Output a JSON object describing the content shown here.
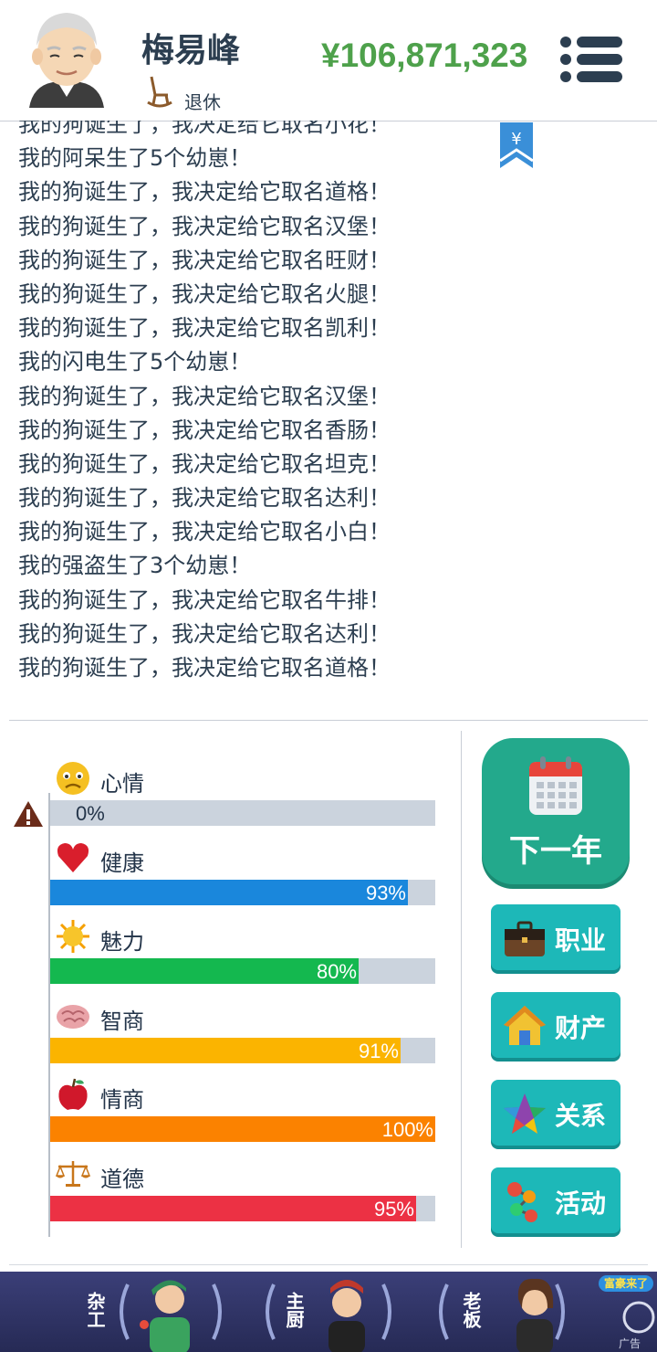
{
  "header": {
    "name": "梅易峰",
    "status": "退休",
    "money": "¥106,871,323"
  },
  "log": {
    "entries": [
      "我的狗诞生了，我决定给它取名小花！",
      "我的阿呆生了5个幼崽！",
      "我的狗诞生了，我决定给它取名道格！",
      "我的狗诞生了，我决定给它取名汉堡！",
      "我的狗诞生了，我决定给它取名旺财！",
      "我的狗诞生了，我决定给它取名火腿！",
      "我的狗诞生了，我决定给它取名凯利！",
      "我的闪电生了5个幼崽！",
      "我的狗诞生了，我决定给它取名汉堡！",
      "我的狗诞生了，我决定给它取名香肠！",
      "我的狗诞生了，我决定给它取名坦克！",
      "我的狗诞生了，我决定给它取名达利！",
      "我的狗诞生了，我决定给它取名小白！",
      "我的强盗生了3个幼崽！",
      "我的狗诞生了，我决定给它取名牛排！",
      "我的狗诞生了，我决定给它取名达利！",
      "我的狗诞生了，我决定给它取名道格！"
    ],
    "bookmark_symbol": "¥"
  },
  "stats": [
    {
      "label": "心情",
      "value": 0,
      "display": "0%",
      "color": "#cbd3dd",
      "icon": "sad-face-icon"
    },
    {
      "label": "健康",
      "value": 93,
      "display": "93%",
      "color": "#1a87dc",
      "icon": "heart-icon"
    },
    {
      "label": "魅力",
      "value": 80,
      "display": "80%",
      "color": "#14b84f",
      "icon": "sun-icon"
    },
    {
      "label": "智商",
      "value": 91,
      "display": "91%",
      "color": "#fbb400",
      "icon": "brain-icon"
    },
    {
      "label": "情商",
      "value": 100,
      "display": "100%",
      "color": "#fb8200",
      "icon": "apple-icon"
    },
    {
      "label": "道德",
      "value": 95,
      "display": "95%",
      "color": "#ec3144",
      "icon": "scales-icon"
    }
  ],
  "actions": {
    "next_year": "下一年",
    "career": "职业",
    "assets": "财产",
    "relations": "关系",
    "activities": "活动"
  },
  "ad": {
    "items": [
      "杂工",
      "主厨",
      "老板"
    ],
    "badge": "富豪来了",
    "mark": "广告"
  }
}
